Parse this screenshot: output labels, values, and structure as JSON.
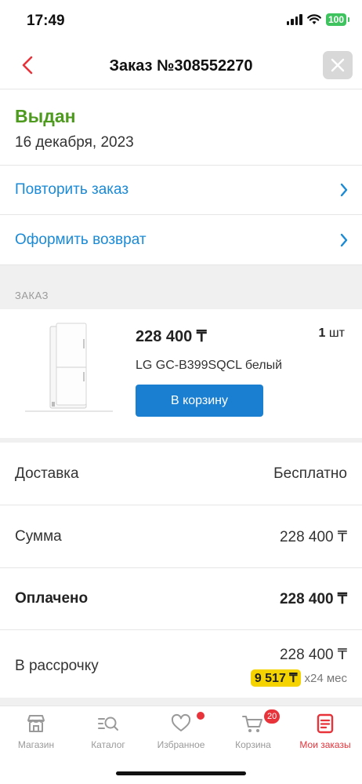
{
  "status_bar": {
    "time": "17:49",
    "battery": "100"
  },
  "header": {
    "title": "Заказ №308552270"
  },
  "order": {
    "status": "Выдан",
    "date": "16 декабря, 2023"
  },
  "actions": {
    "repeat": "Повторить заказ",
    "return": "Оформить возврат"
  },
  "section": {
    "label": "ЗАКАЗ"
  },
  "product": {
    "price": "228 400 ₸",
    "qty_number": "1",
    "qty_unit": "шт",
    "name": "LG GC-B399SQCL белый",
    "cart_button": "В корзину"
  },
  "summary": {
    "delivery_label": "Доставка",
    "delivery_value": "Бесплатно",
    "sum_label": "Сумма",
    "sum_value": "228 400 ₸",
    "paid_label": "Оплачено",
    "paid_value": "228 400 ₸",
    "installment_label": "В рассрочку",
    "installment_value": "228 400 ₸",
    "monthly_payment": "9 517 ₸",
    "monthly_term": "x24 мес"
  },
  "tabbar": {
    "items": [
      {
        "label": "Магазин",
        "icon": "store-icon"
      },
      {
        "label": "Каталог",
        "icon": "catalog-search-icon"
      },
      {
        "label": "Избранное",
        "icon": "heart-icon"
      },
      {
        "label": "Корзина",
        "icon": "cart-icon",
        "badge": "20"
      },
      {
        "label": "Мои заказы",
        "icon": "orders-icon"
      }
    ]
  },
  "colors": {
    "accent_red": "#e8333a",
    "link_blue": "#1a8ad6",
    "status_green": "#4e9a1f",
    "button_blue": "#1a7fd0",
    "installment_yellow": "#f5d300"
  }
}
